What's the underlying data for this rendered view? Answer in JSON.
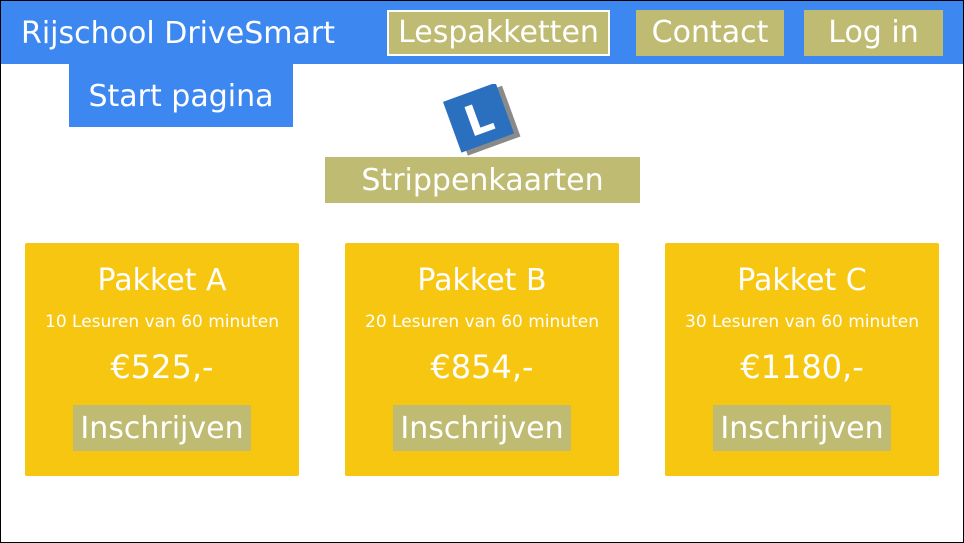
{
  "header": {
    "brand": "Rijschool DriveSmart",
    "nav": {
      "lespakketten": "Lespakketten",
      "contact": "Contact",
      "login": "Log in"
    },
    "start_page": "Start pagina"
  },
  "logo": {
    "icon": "learner-plate-L-icon",
    "letter": "L"
  },
  "section": {
    "title": "Strippenkaarten"
  },
  "packages": [
    {
      "name": "Pakket A",
      "description": "10 Lesuren van 60 minuten",
      "price": "€525,-",
      "button": "Inschrijven"
    },
    {
      "name": "Pakket B",
      "description": "20 Lesuren van 60 minuten",
      "price": "€854,-",
      "button": "Inschrijven"
    },
    {
      "name": "Pakket C",
      "description": "30 Lesuren van 60 minuten",
      "price": "€1180,-",
      "button": "Inschrijven"
    }
  ],
  "colors": {
    "header_blue": "#3d87f0",
    "button_olive": "#bfbb72",
    "card_yellow": "#f6c611",
    "logo_blue": "#2b6fbf"
  }
}
